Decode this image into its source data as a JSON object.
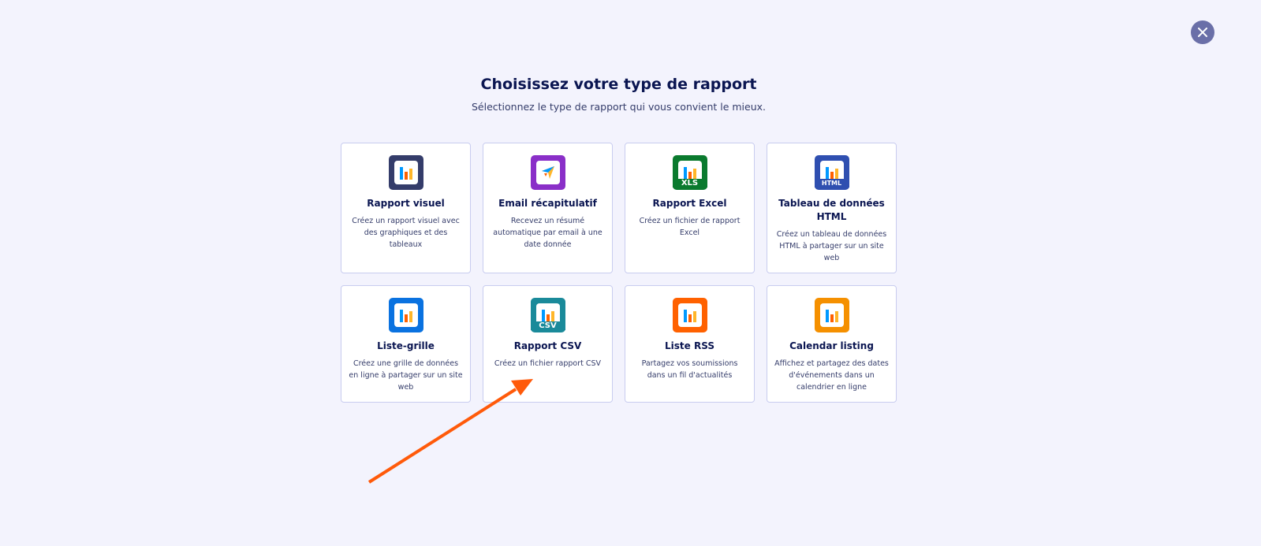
{
  "header": {
    "title": "Choisissez votre type de rapport",
    "subtitle": "Sélectionnez le type de rapport qui vous convient le mieux."
  },
  "close_icon": "close-icon",
  "cards": [
    {
      "title": "Rapport visuel",
      "desc": "Créez un rapport visuel avec des graphiques et des tableaux",
      "color": "#343c6a",
      "badge": ""
    },
    {
      "title": "Email récapitulatif",
      "desc": "Recevez un résumé automatique par email à une date donnée",
      "color": "#8a2fc8",
      "badge": ""
    },
    {
      "title": "Rapport Excel",
      "desc": "Créez un fichier de rapport Excel",
      "color": "#0a7a2e",
      "badge": "XLS"
    },
    {
      "title": "Tableau de données HTML",
      "desc": "Créez un tableau de données HTML à partager sur un site web",
      "color": "#2f4fb0",
      "badge": "HTML"
    },
    {
      "title": "Liste-grille",
      "desc": "Créez une grille de données en ligne à partager sur un site web",
      "color": "#0a72e0",
      "badge": ""
    },
    {
      "title": "Rapport CSV",
      "desc": "Créez un fichier rapport CSV",
      "color": "#1a8a9a",
      "badge": "CSV"
    },
    {
      "title": "Liste RSS",
      "desc": "Partagez vos soumissions dans un fil d'actualités",
      "color": "#ff6100",
      "badge": ""
    },
    {
      "title": "Calendar listing",
      "desc": "Affichez et partagez des dates d'événements dans un calendrier en ligne",
      "color": "#f59000",
      "badge": ""
    }
  ],
  "annotation": {
    "arrow_color": "#ff5a0a"
  }
}
